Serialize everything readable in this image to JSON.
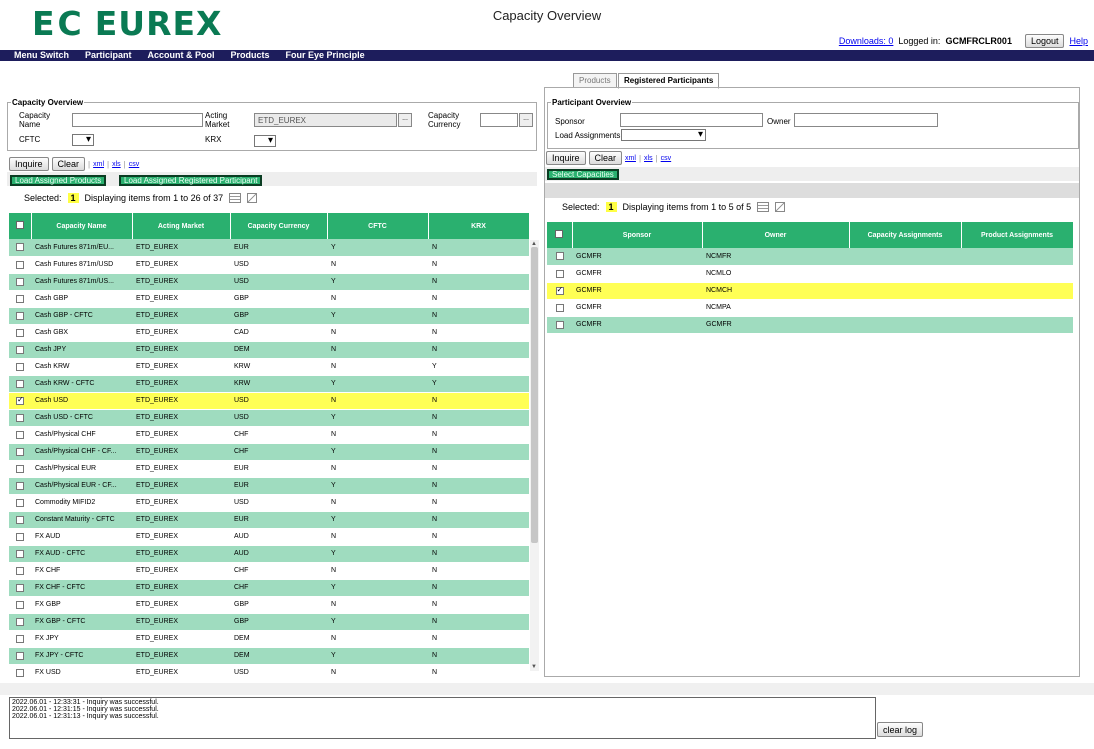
{
  "app": {
    "logo_ec": "EC",
    "logo_text": "EUREX",
    "title": "Capacity Overview"
  },
  "topbar": {
    "downloads": "Downloads: 0",
    "logged_in_label": "Logged in:",
    "user": "GCMFRCLR001",
    "logout": "Logout",
    "help": "Help"
  },
  "menu": [
    "Menu Switch",
    "Participant",
    "Account & Pool",
    "Products",
    "Four Eye Principle"
  ],
  "left": {
    "legend": "Capacity Overview",
    "capacity_name_label": "Capacity Name",
    "capacity_name_value": "",
    "acting_market_label": "Acting Market",
    "acting_market_value": "ETD_EUREX",
    "capacity_currency_label": "Capacity Currency",
    "capacity_currency_value": "",
    "cftc_label": "CFTC",
    "cftc_value": "",
    "krx_label": "KRX",
    "krx_value": "",
    "dots": "...",
    "inquire": "Inquire",
    "clear": "Clear",
    "xml": "xml",
    "xls": "xls",
    "csv": "csv",
    "load_products": "Load Assigned Products",
    "load_participants": "Load Assigned Registered Participant",
    "selected_label": "Selected:",
    "selected_count": "1",
    "display_text": "Displaying items from 1 to 26 of 37",
    "columns": [
      "Capacity Name",
      "Acting Market",
      "Capacity Currency",
      "CFTC",
      "KRX"
    ],
    "rows": [
      {
        "name": "Cash Futures 871m/EU...",
        "market": "ETD_EUREX",
        "currency": "EUR",
        "cftc": "Y",
        "krx": "N"
      },
      {
        "name": "Cash Futures 871m/USD",
        "market": "ETD_EUREX",
        "currency": "USD",
        "cftc": "N",
        "krx": "N"
      },
      {
        "name": "Cash Futures 871m/US...",
        "market": "ETD_EUREX",
        "currency": "USD",
        "cftc": "Y",
        "krx": "N"
      },
      {
        "name": "Cash GBP",
        "market": "ETD_EUREX",
        "currency": "GBP",
        "cftc": "N",
        "krx": "N"
      },
      {
        "name": "Cash GBP - CFTC",
        "market": "ETD_EUREX",
        "currency": "GBP",
        "cftc": "Y",
        "krx": "N"
      },
      {
        "name": "Cash GBX",
        "market": "ETD_EUREX",
        "currency": "CAD",
        "cftc": "N",
        "krx": "N"
      },
      {
        "name": "Cash JPY",
        "market": "ETD_EUREX",
        "currency": "DEM",
        "cftc": "N",
        "krx": "N"
      },
      {
        "name": "Cash KRW",
        "market": "ETD_EUREX",
        "currency": "KRW",
        "cftc": "N",
        "krx": "Y"
      },
      {
        "name": "Cash KRW - CFTC",
        "market": "ETD_EUREX",
        "currency": "KRW",
        "cftc": "Y",
        "krx": "Y"
      },
      {
        "name": "Cash USD",
        "market": "ETD_EUREX",
        "currency": "USD",
        "cftc": "N",
        "krx": "N",
        "selected": true
      },
      {
        "name": "Cash USD - CFTC",
        "market": "ETD_EUREX",
        "currency": "USD",
        "cftc": "Y",
        "krx": "N"
      },
      {
        "name": "Cash/Physical CHF",
        "market": "ETD_EUREX",
        "currency": "CHF",
        "cftc": "N",
        "krx": "N"
      },
      {
        "name": "Cash/Physical CHF - CF...",
        "market": "ETD_EUREX",
        "currency": "CHF",
        "cftc": "Y",
        "krx": "N"
      },
      {
        "name": "Cash/Physical EUR",
        "market": "ETD_EUREX",
        "currency": "EUR",
        "cftc": "N",
        "krx": "N"
      },
      {
        "name": "Cash/Physical EUR - CF...",
        "market": "ETD_EUREX",
        "currency": "EUR",
        "cftc": "Y",
        "krx": "N"
      },
      {
        "name": "Commodity MIFID2",
        "market": "ETD_EUREX",
        "currency": "USD",
        "cftc": "N",
        "krx": "N"
      },
      {
        "name": "Constant Maturity - CFTC",
        "market": "ETD_EUREX",
        "currency": "EUR",
        "cftc": "Y",
        "krx": "N"
      },
      {
        "name": "FX AUD",
        "market": "ETD_EUREX",
        "currency": "AUD",
        "cftc": "N",
        "krx": "N"
      },
      {
        "name": "FX AUD - CFTC",
        "market": "ETD_EUREX",
        "currency": "AUD",
        "cftc": "Y",
        "krx": "N"
      },
      {
        "name": "FX CHF",
        "market": "ETD_EUREX",
        "currency": "CHF",
        "cftc": "N",
        "krx": "N"
      },
      {
        "name": "FX CHF - CFTC",
        "market": "ETD_EUREX",
        "currency": "CHF",
        "cftc": "Y",
        "krx": "N"
      },
      {
        "name": "FX GBP",
        "market": "ETD_EUREX",
        "currency": "GBP",
        "cftc": "N",
        "krx": "N"
      },
      {
        "name": "FX GBP - CFTC",
        "market": "ETD_EUREX",
        "currency": "GBP",
        "cftc": "Y",
        "krx": "N"
      },
      {
        "name": "FX JPY",
        "market": "ETD_EUREX",
        "currency": "DEM",
        "cftc": "N",
        "krx": "N"
      },
      {
        "name": "FX JPY - CFTC",
        "market": "ETD_EUREX",
        "currency": "DEM",
        "cftc": "Y",
        "krx": "N"
      },
      {
        "name": "FX USD",
        "market": "ETD_EUREX",
        "currency": "USD",
        "cftc": "N",
        "krx": "N"
      }
    ]
  },
  "right": {
    "tabs": [
      "Products",
      "Registered Participants"
    ],
    "legend": "Participant Overview",
    "sponsor_label": "Sponsor",
    "sponsor_value": "",
    "owner_label": "Owner",
    "owner_value": "",
    "load_assignments_label": "Load Assignments",
    "load_assignments_value": "",
    "inquire": "Inquire",
    "clear": "Clear",
    "xml": "xml",
    "xls": "xls",
    "csv": "csv",
    "select_capacities": "Select Capacities",
    "selected_label": "Selected:",
    "selected_count": "1",
    "display_text": "Displaying items from 1 to 5 of 5",
    "columns": [
      "Sponsor",
      "Owner",
      "Capacity Assignments",
      "Product Assignments"
    ],
    "rows": [
      {
        "sponsor": "GCMFR",
        "owner": "NCMFR",
        "cap": "",
        "prod": ""
      },
      {
        "sponsor": "GCMFR",
        "owner": "NCMLO",
        "cap": "",
        "prod": ""
      },
      {
        "sponsor": "GCMFR",
        "owner": "NCMCH",
        "cap": "",
        "prod": "",
        "selected": true
      },
      {
        "sponsor": "GCMFR",
        "owner": "NCMPA",
        "cap": "",
        "prod": ""
      },
      {
        "sponsor": "GCMFR",
        "owner": "GCMFR",
        "cap": "",
        "prod": ""
      }
    ]
  },
  "log": {
    "lines": [
      "2022.06.01 - 12:33:31 - Inquiry was successful.",
      "2022.06.01 - 12:31:15 - Inquiry was successful.",
      "2022.06.01 - 12:31:13 - Inquiry was successful."
    ],
    "clear_log": "clear log"
  },
  "colors": {
    "green": "#2ab06f",
    "lightgreen": "#9fdcbf",
    "selected": "#ffff55",
    "menubar": "#1d1d5c"
  }
}
